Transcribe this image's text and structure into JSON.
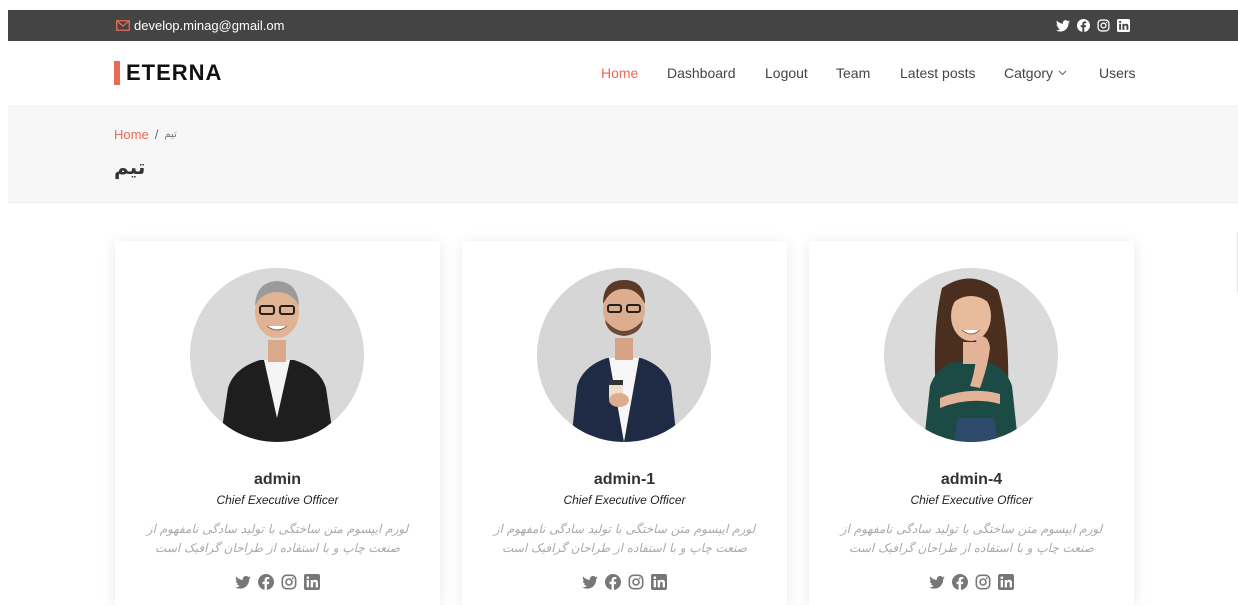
{
  "topbar": {
    "email": "develop.minag@gmail.om",
    "socials": [
      "twitter-icon",
      "facebook-icon",
      "instagram-icon",
      "linkedin-icon"
    ]
  },
  "header": {
    "logo": "ETERNA",
    "nav": [
      {
        "label": "Home",
        "active": true
      },
      {
        "label": "Dashboard",
        "active": false
      },
      {
        "label": "Logout",
        "active": false
      },
      {
        "label": "Team",
        "active": false
      },
      {
        "label": "Latest posts",
        "active": false
      },
      {
        "label": "Catgory",
        "active": false,
        "dropdown": true
      },
      {
        "label": "Users",
        "active": false
      }
    ]
  },
  "breadcrumbs": {
    "home": "Home",
    "separator": "/",
    "current": "تیم",
    "title": "تیم"
  },
  "team": [
    {
      "name": "admin",
      "role": "Chief Executive Officer",
      "bio_line1": "لورم ایپسوم متن ساختگی با تولید سادگی نامفهوم از",
      "bio_line2": "صنعت چاپ و با استفاده از طراحان گرافیک است"
    },
    {
      "name": "admin-1",
      "role": "Chief Executive Officer",
      "bio_line1": "لورم ایپسوم متن ساختگی با تولید سادگی نامفهوم از",
      "bio_line2": "صنعت چاپ و با استفاده از طراحان گرافیک است"
    },
    {
      "name": "admin-4",
      "role": "Chief Executive Officer",
      "bio_line1": "لورم ایپسوم متن ساختگی با تولید سادگی نامفهوم از",
      "bio_line2": "صنعت چاپ و با استفاده از طراحان گرافیک است"
    }
  ],
  "colors": {
    "accent": "#e96b56",
    "topbar": "#444444",
    "breadcrumb_bg": "#f7f7f7"
  }
}
